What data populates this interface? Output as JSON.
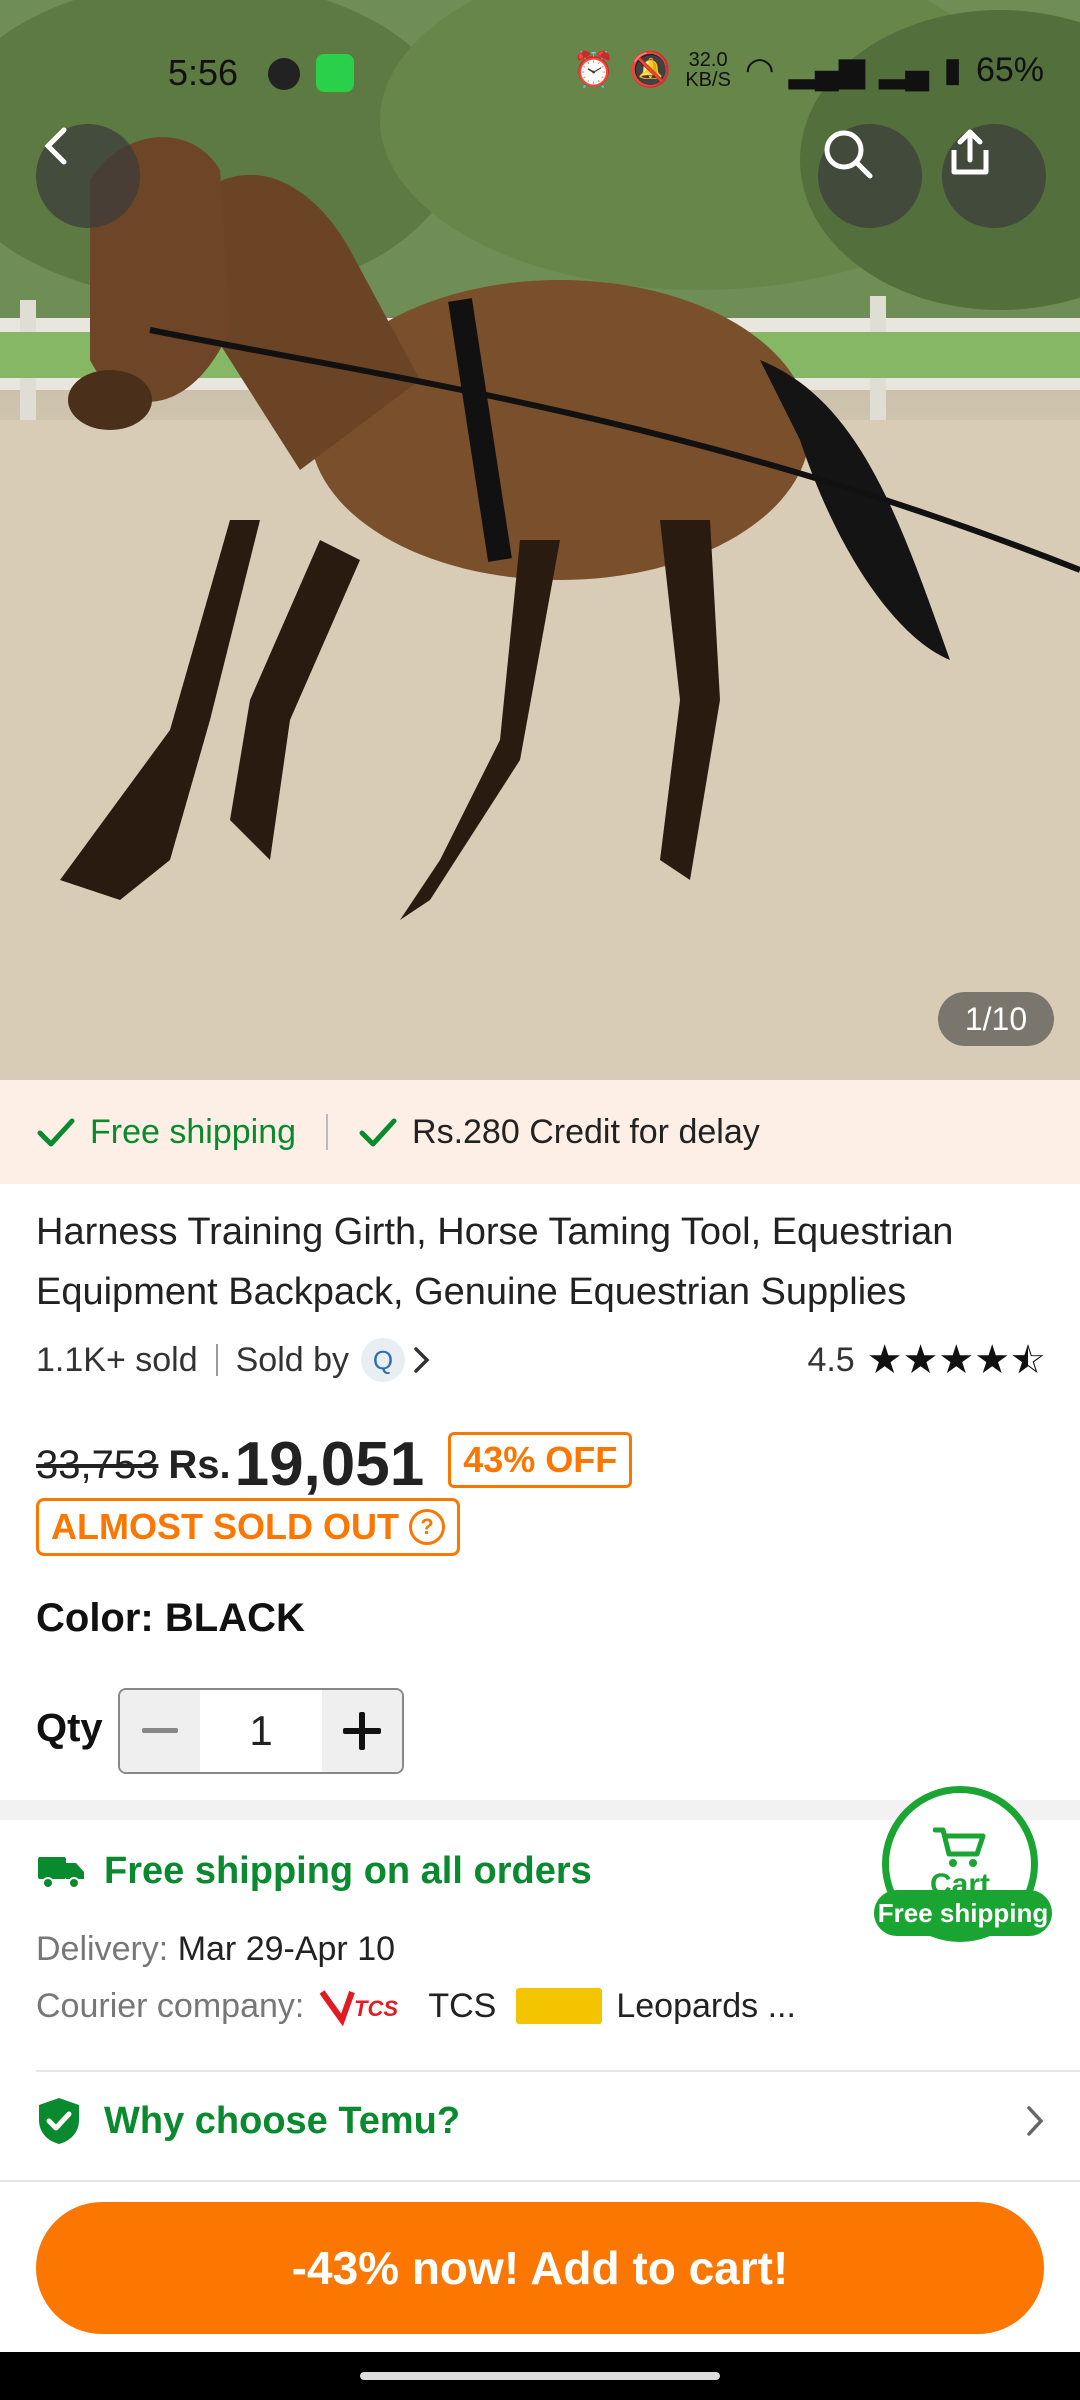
{
  "status_bar": {
    "time": "5:56",
    "net_speed_value": "32.0",
    "net_speed_unit": "KB/S",
    "battery": "65%"
  },
  "gallery": {
    "counter": "1/10",
    "image_desc_icon": "horse-photo"
  },
  "shipping_banner": {
    "free_shipping": "Free shipping",
    "credit": "Rs.280 Credit for delay"
  },
  "product": {
    "title": "Harness Training Girth, Horse Taming Tool, Equestrian Equipment Backpack, Genuine Equestrian Supplies",
    "sold": "1.1K+ sold",
    "sold_by": "Sold by",
    "rating": "4.5",
    "rating_stars": 4.5,
    "original_price": "33,753",
    "currency": "Rs.",
    "price": "19,051",
    "discount": "43% OFF",
    "stock_status": "ALMOST SOLD OUT",
    "color_label": "Color: BLACK",
    "qty_label": "Qty",
    "qty_value": "1"
  },
  "shipping": {
    "headline": "Free shipping on all orders",
    "delivery_label": "Delivery:",
    "delivery_dates": "Mar 29-Apr 10",
    "courier_label": "Courier company:",
    "courier_1": "TCS",
    "courier_2": "Leopards ..."
  },
  "why": {
    "label": "Why choose Temu?"
  },
  "cart_float": {
    "label": "Cart",
    "badge": "Free shipping"
  },
  "cta": {
    "label": "-43% now! Add to cart!"
  },
  "colors": {
    "accent_orange": "#fb7701",
    "accent_green": "#0a8a2e",
    "banner_bg": "#fdeee6"
  }
}
